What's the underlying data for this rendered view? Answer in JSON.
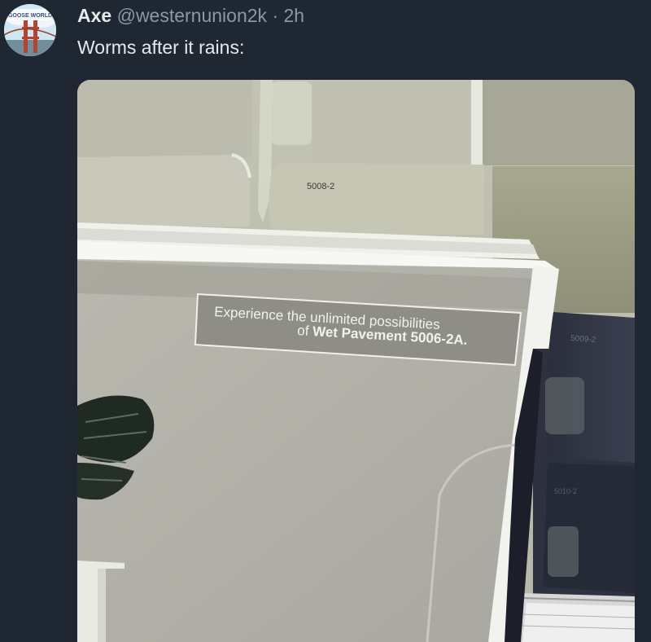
{
  "tweet": {
    "author_name": "Axe",
    "handle": "@westernunion2k",
    "separator": "·",
    "time": "2h",
    "text": "Worms after it rains:"
  },
  "avatar": {
    "badge_text": "GOOSE WORLD"
  },
  "media": {
    "chip_code_top": "5008-2",
    "chip_code_right": "5009-2",
    "chip_code_lower": "5010-2",
    "card_line1": "Experience the unlimited possibilities",
    "card_line2_prefix": "of ",
    "card_line2_bold": "Wet Pavement 5006-2A."
  }
}
